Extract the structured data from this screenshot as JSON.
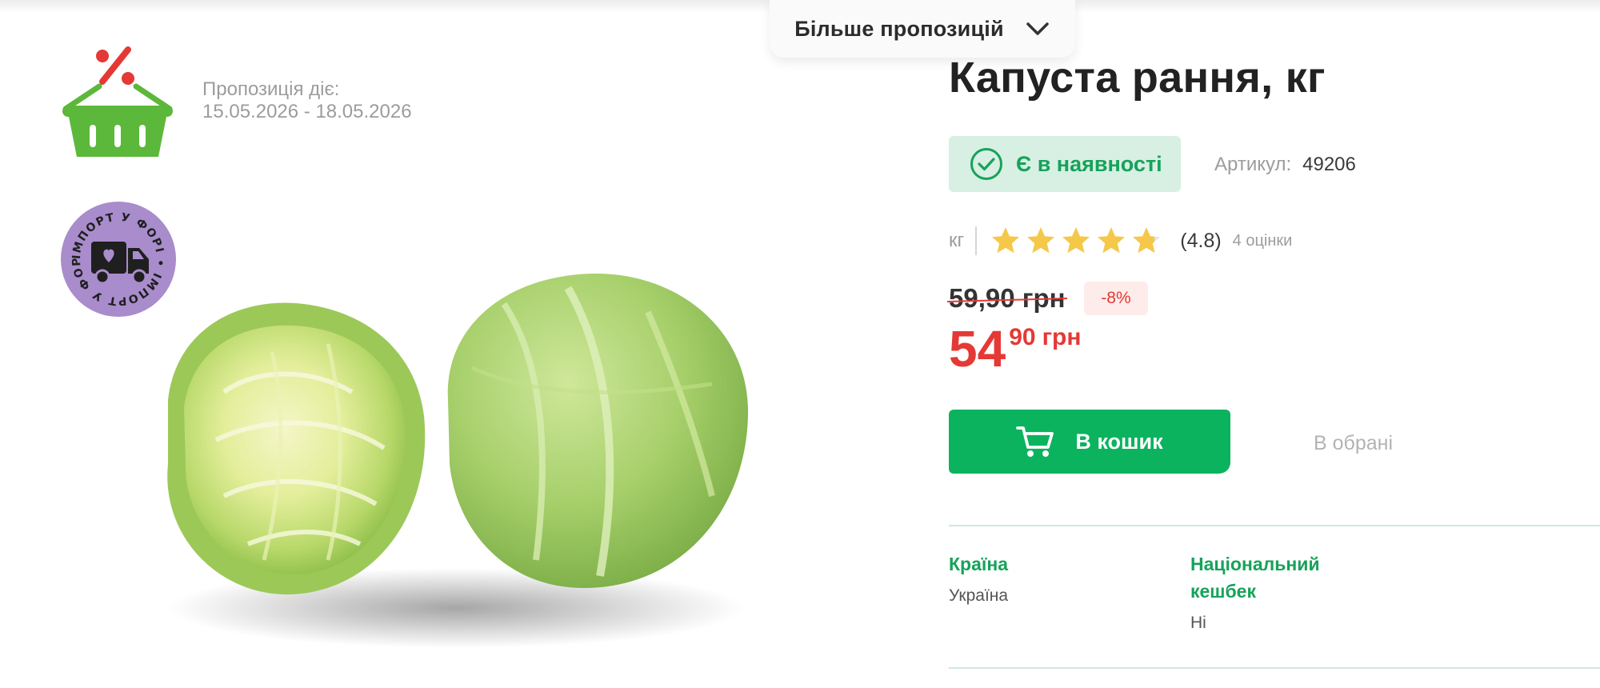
{
  "header": {
    "more_offers_label": "Більше пропозицій",
    "more_offers_icon": "chevron-down-icon"
  },
  "promo": {
    "icon": "discount-basket-icon",
    "offer_label": "Пропозиція діє:",
    "offer_dates": "15.05.2026 - 18.05.2026",
    "import_badge_text": "ІМПОРТ У ФОРІ • ІМПОРТ У ФОРІ •",
    "import_badge_icon": "truck-icon"
  },
  "product": {
    "title": "Капуста рання, кг",
    "stock_label": "Є в наявності",
    "sku_label": "Артикул:",
    "sku_value": "49206",
    "unit": "кг",
    "rating_value": 4.8,
    "rating_text": "(4.8)",
    "rating_count": "4 оцінки",
    "old_price": "59,90 грн",
    "discount": "-8%",
    "price_int": "54",
    "price_dec": "90",
    "currency": "грн",
    "add_to_cart": "В кошик",
    "favorites": "В обрані"
  },
  "attributes": [
    {
      "label": "Країна",
      "value": "Україна"
    },
    {
      "label": "Національний кешбек",
      "value": "Ні"
    }
  ],
  "colors": {
    "accent_green": "#0bb35e",
    "stock_bg": "#d8efe3",
    "price_red": "#e53935",
    "star_yellow": "#f5c84a",
    "badge_purple": "#a98ccc"
  }
}
